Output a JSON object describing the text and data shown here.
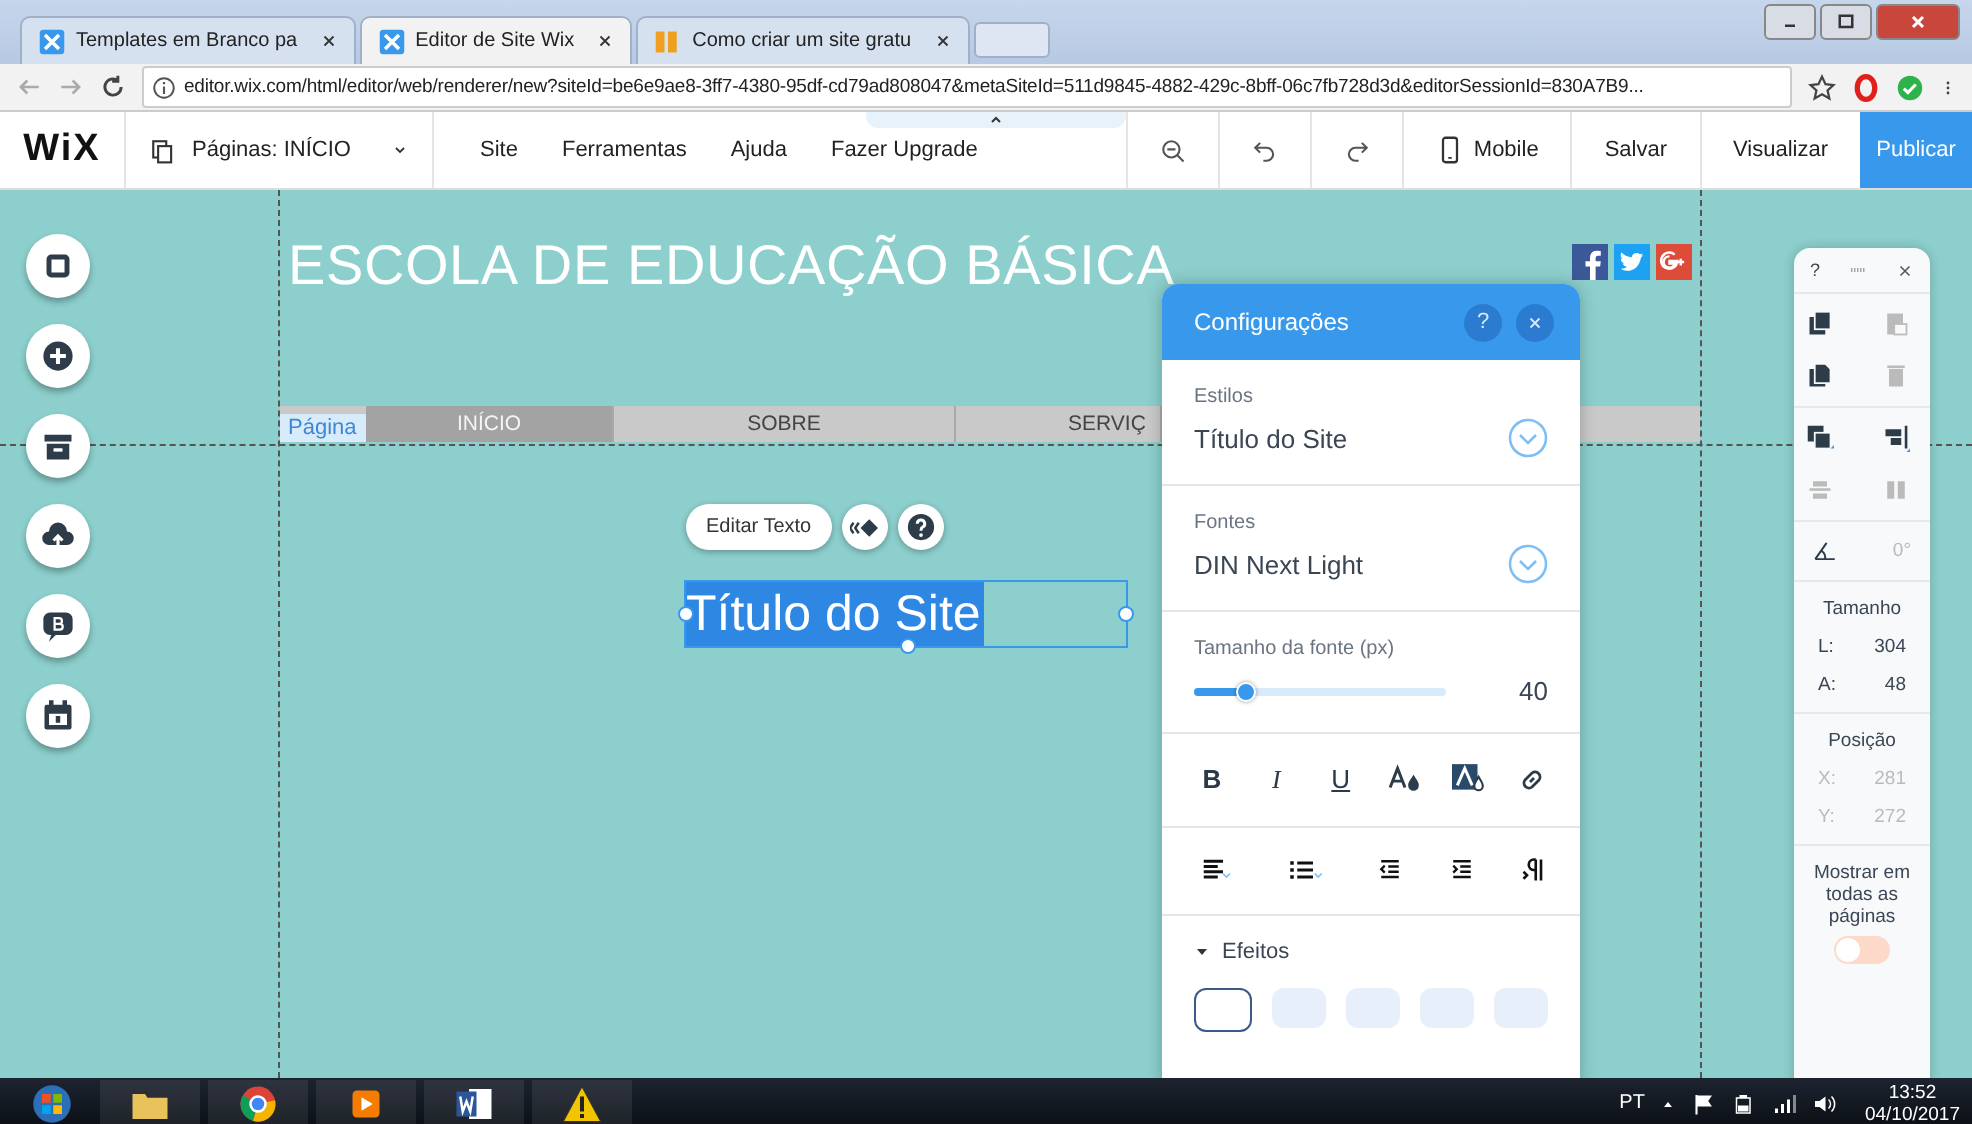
{
  "browser": {
    "tabs": [
      {
        "title": "Templates em Branco pa",
        "selected": false
      },
      {
        "title": "Editor de Site Wix",
        "selected": true
      },
      {
        "title": "Como criar um site gratu",
        "selected": false
      }
    ],
    "url": "editor.wix.com/html/editor/web/renderer/new?siteId=be6e9ae8-3ff7-4380-95df-cd79ad808047&metaSiteId=511d9845-4882-429c-8bff-06c7fb728d3d&editorSessionId=830A7B9..."
  },
  "editor_bar": {
    "logo": "WiX",
    "pages": "Páginas: INÍCIO",
    "menu": [
      "Site",
      "Ferramentas",
      "Ajuda",
      "Fazer Upgrade"
    ],
    "mobile": "Mobile",
    "save": "Salvar",
    "preview": "Visualizar",
    "publish": "Publicar"
  },
  "canvas": {
    "site_title": "ESCOLA DE EDUCAÇÃO BÁSICA",
    "nav": [
      {
        "label": "INÍCIO",
        "selected": true
      },
      {
        "label": "SOBRE",
        "selected": false
      },
      {
        "label": "SERVIÇ",
        "selected": false
      }
    ],
    "page_label": "Página",
    "edit_text_button": "Editar Texto",
    "selected_text": "Título do Site"
  },
  "settings_panel": {
    "title": "Configurações",
    "help": "?",
    "styles": {
      "label": "Estilos",
      "value": "Título do Site"
    },
    "fonts": {
      "label": "Fontes",
      "value": "DIN Next Light"
    },
    "font_size": {
      "label": "Tamanho da fonte (px)",
      "level": 0.2,
      "reading": "40"
    },
    "format": [
      "B",
      "I",
      "U"
    ],
    "effects": {
      "label": "Efeitos",
      "expanded": true
    }
  },
  "layout_panel": {
    "help": "?",
    "rotation": "0°",
    "size_heading": "Tamanho",
    "size": [
      {
        "label": "L:",
        "value": "304",
        "disabled": false
      },
      {
        "label": "A:",
        "value": "48",
        "disabled": false
      }
    ],
    "position_heading": "Posição",
    "position": [
      {
        "label": "X:",
        "value": "281",
        "disabled": true
      },
      {
        "label": "Y:",
        "value": "272",
        "disabled": true
      }
    ],
    "show_all_pages": {
      "label": "Mostrar em todas as páginas",
      "on": false
    }
  },
  "taskbar": {
    "language": "PT",
    "time": "13:52",
    "date": "04/10/2017"
  }
}
